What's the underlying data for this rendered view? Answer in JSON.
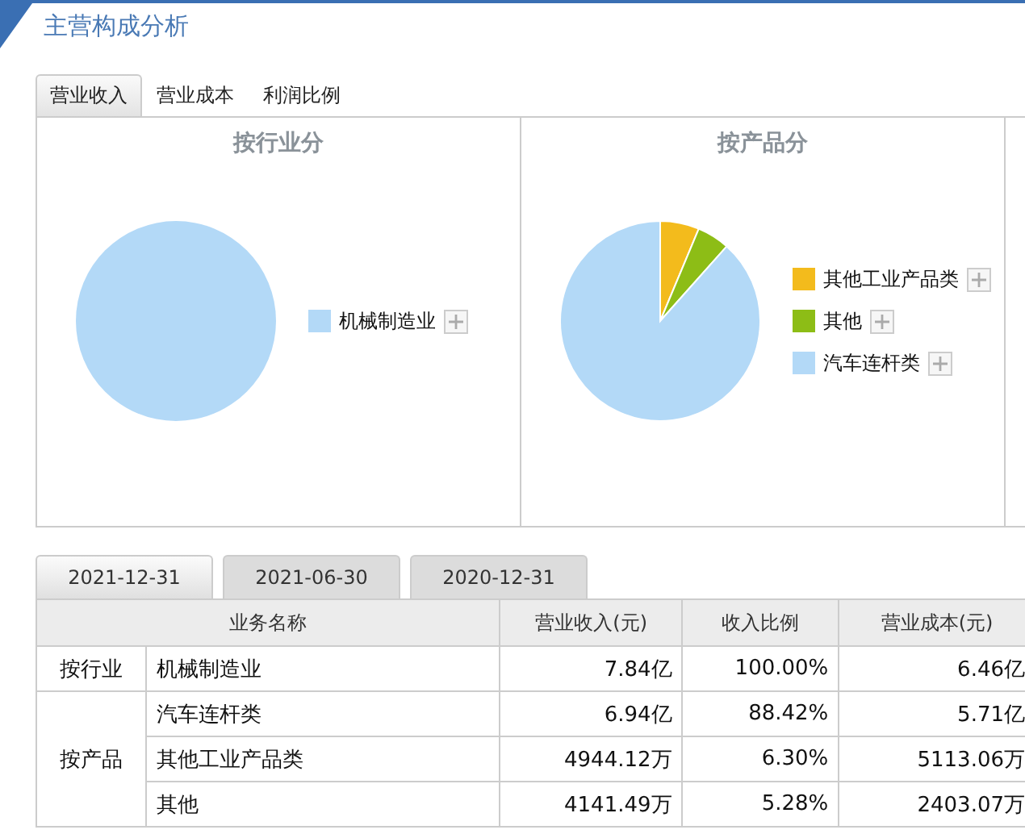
{
  "header": {
    "title": "主营构成分析"
  },
  "tabs": [
    {
      "label": "营业收入",
      "selected": true
    },
    {
      "label": "营业成本",
      "selected": false
    },
    {
      "label": "利润比例",
      "selected": false
    }
  ],
  "charts": [
    {
      "chart_data": {
        "type": "pie",
        "title": "按行业分",
        "categories": [
          "机械制造业"
        ],
        "colors": [
          "#b3d9f7"
        ],
        "values": [
          100.0
        ]
      }
    },
    {
      "chart_data": {
        "type": "pie",
        "title": "按产品分",
        "categories": [
          "其他工业产品类",
          "其他",
          "汽车连杆类"
        ],
        "colors": [
          "#f3bb1c",
          "#8dbd16",
          "#b3d9f7"
        ],
        "values": [
          6.3,
          5.28,
          88.42
        ]
      }
    }
  ],
  "date_tabs": [
    {
      "label": "2021-12-31",
      "selected": true
    },
    {
      "label": "2021-06-30",
      "selected": false
    },
    {
      "label": "2020-12-31",
      "selected": false
    }
  ],
  "table": {
    "columns": [
      "业务名称",
      "营业收入(元)",
      "收入比例",
      "营业成本(元)"
    ],
    "groups": [
      {
        "label": "按行业",
        "rows": [
          [
            "机械制造业",
            "7.84亿",
            "100.00%",
            "6.46亿"
          ]
        ]
      },
      {
        "label": "按产品",
        "rows": [
          [
            "汽车连杆类",
            "6.94亿",
            "88.42%",
            "5.71亿"
          ],
          [
            "其他工业产品类",
            "4944.12万",
            "6.30%",
            "5113.06万"
          ],
          [
            "其他",
            "4141.49万",
            "5.28%",
            "2403.07万"
          ]
        ]
      }
    ]
  }
}
